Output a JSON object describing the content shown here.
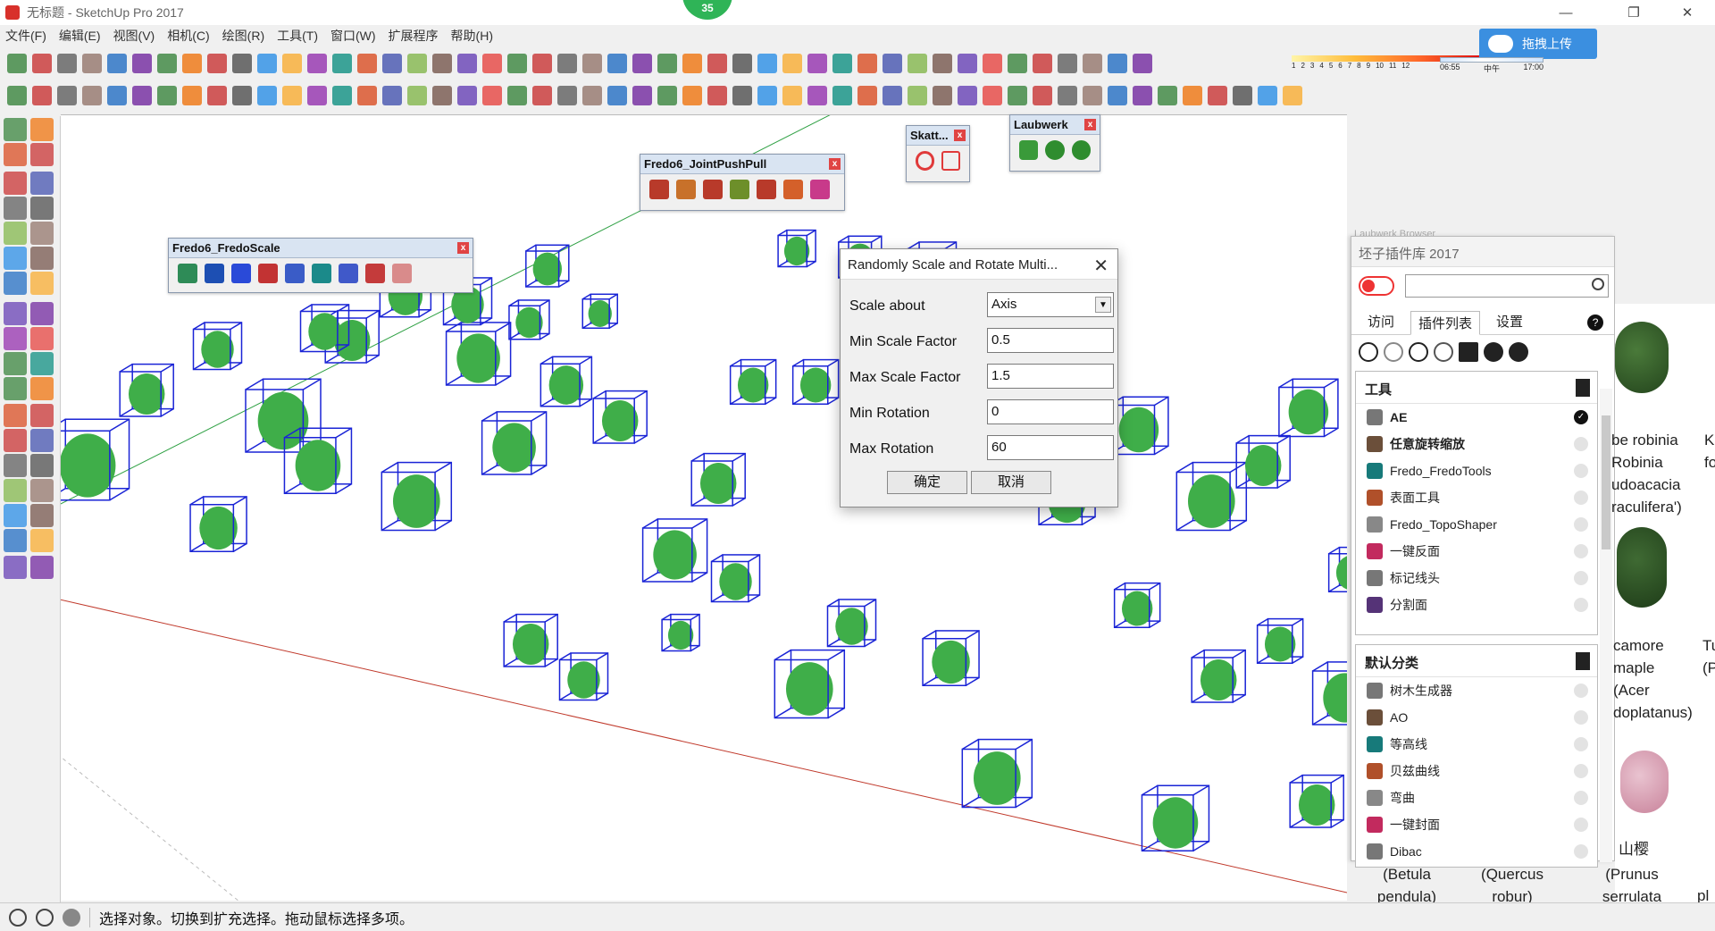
{
  "window": {
    "title": "无标题 - SketchUp Pro 2017",
    "badge": "35",
    "upload_label": "拖拽上传"
  },
  "menu": [
    "文件(F)",
    "编辑(E)",
    "视图(V)",
    "相机(C)",
    "绘图(R)",
    "工具(T)",
    "窗口(W)",
    "扩展程序",
    "帮助(H)"
  ],
  "timebar": {
    "months": [
      "1",
      "2",
      "3",
      "4",
      "5",
      "6",
      "7",
      "8",
      "9",
      "10",
      "11",
      "12"
    ],
    "time_start": "06:55",
    "time_mid": "中午",
    "time_end": "17:00"
  },
  "floating_toolbars": {
    "fredo_scale": "Fredo6_FredoScale",
    "joint_push_pull": "Fredo6_JointPushPull",
    "skatter": "Skatt...",
    "laubwerk": "Laubwerk"
  },
  "dialog": {
    "title": "Randomly Scale and Rotate Multi...",
    "fields": [
      {
        "label": "Scale about",
        "value": "Axis"
      },
      {
        "label": "Min Scale Factor",
        "value": "0.5"
      },
      {
        "label": "Max Scale Factor",
        "value": "1.5"
      },
      {
        "label": "Min Rotation",
        "value": "0"
      },
      {
        "label": "Max Rotation",
        "value": "60"
      }
    ],
    "ok_label": "确定",
    "cancel_label": "取消"
  },
  "plugin_panel": {
    "title": "坯子插件库 2017",
    "behind_title": "Laubwerk Browser",
    "tabs": [
      "访问",
      "插件列表",
      "设置"
    ],
    "active_tab": "插件列表",
    "sections": [
      {
        "title": "工具",
        "items": [
          {
            "label": "AE",
            "checked": true
          },
          {
            "label": "任意旋转缩放",
            "checked": false
          },
          {
            "label": "Fredo_FredoTools",
            "checked": false
          },
          {
            "label": "表面工具",
            "checked": false
          },
          {
            "label": "Fredo_TopoShaper",
            "checked": false
          },
          {
            "label": "一键反面",
            "checked": false
          },
          {
            "label": "标记线头",
            "checked": false
          },
          {
            "label": "分割面",
            "checked": false
          }
        ]
      },
      {
        "title": "默认分类",
        "items": [
          {
            "label": "树木生成器",
            "checked": false
          },
          {
            "label": "AO",
            "checked": false
          },
          {
            "label": "等高线",
            "checked": false
          },
          {
            "label": "贝兹曲线",
            "checked": false
          },
          {
            "label": "弯曲",
            "checked": false
          },
          {
            "label": "一键封面",
            "checked": false
          },
          {
            "label": "Dibac",
            "checked": false
          }
        ]
      }
    ]
  },
  "browser": {
    "captions": [
      "be robinia\nRobinia\nudoacacia\nraculifera')",
      "Ka\nfo",
      "camore\nmaple\n(Acer\ndoplatanus)",
      "Tu\n(Pl",
      "山樱",
      "(Betula\npendula)",
      "(Quercus\nrobur)",
      "(Prunus\nserrulata\n'Kanzan')",
      "pl"
    ]
  },
  "status": {
    "text": "选择对象。切换到扩充选择。拖动鼠标选择多项。"
  },
  "colors": {
    "tree_green": "#3fae49",
    "bbox_blue": "#1a24d6",
    "axis_red": "#c0392b",
    "axis_green": "#2ea043",
    "upload_blue": "#3b8fe0"
  }
}
